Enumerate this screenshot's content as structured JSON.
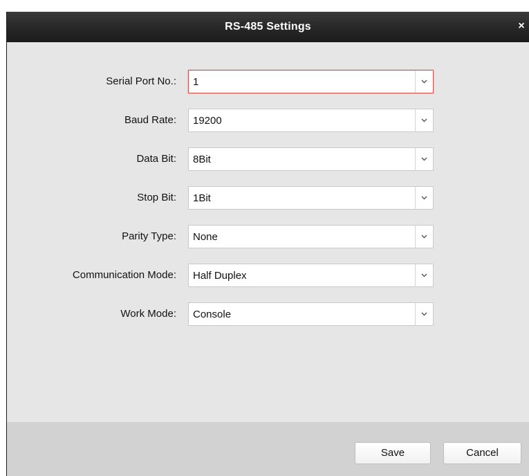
{
  "dialog": {
    "title": "RS-485 Settings",
    "close_glyph": "×"
  },
  "fields": [
    {
      "label": "Serial Port No.:",
      "value": "1",
      "focused": true
    },
    {
      "label": "Baud Rate:",
      "value": "19200"
    },
    {
      "label": "Data Bit:",
      "value": "8Bit"
    },
    {
      "label": "Stop Bit:",
      "value": "1Bit"
    },
    {
      "label": "Parity Type:",
      "value": "None"
    },
    {
      "label": "Communication Mode:",
      "value": "Half Duplex"
    },
    {
      "label": "Work Mode:",
      "value": "Console"
    }
  ],
  "footer": {
    "save_label": "Save",
    "cancel_label": "Cancel"
  },
  "colors": {
    "titlebar": "#2a2a2a",
    "panel": "#e6e6e6",
    "footer": "#d2d2d2",
    "focus_border": "#d9534f"
  },
  "icons": {
    "close": "close-icon",
    "dropdown": "chevron-down-icon"
  }
}
